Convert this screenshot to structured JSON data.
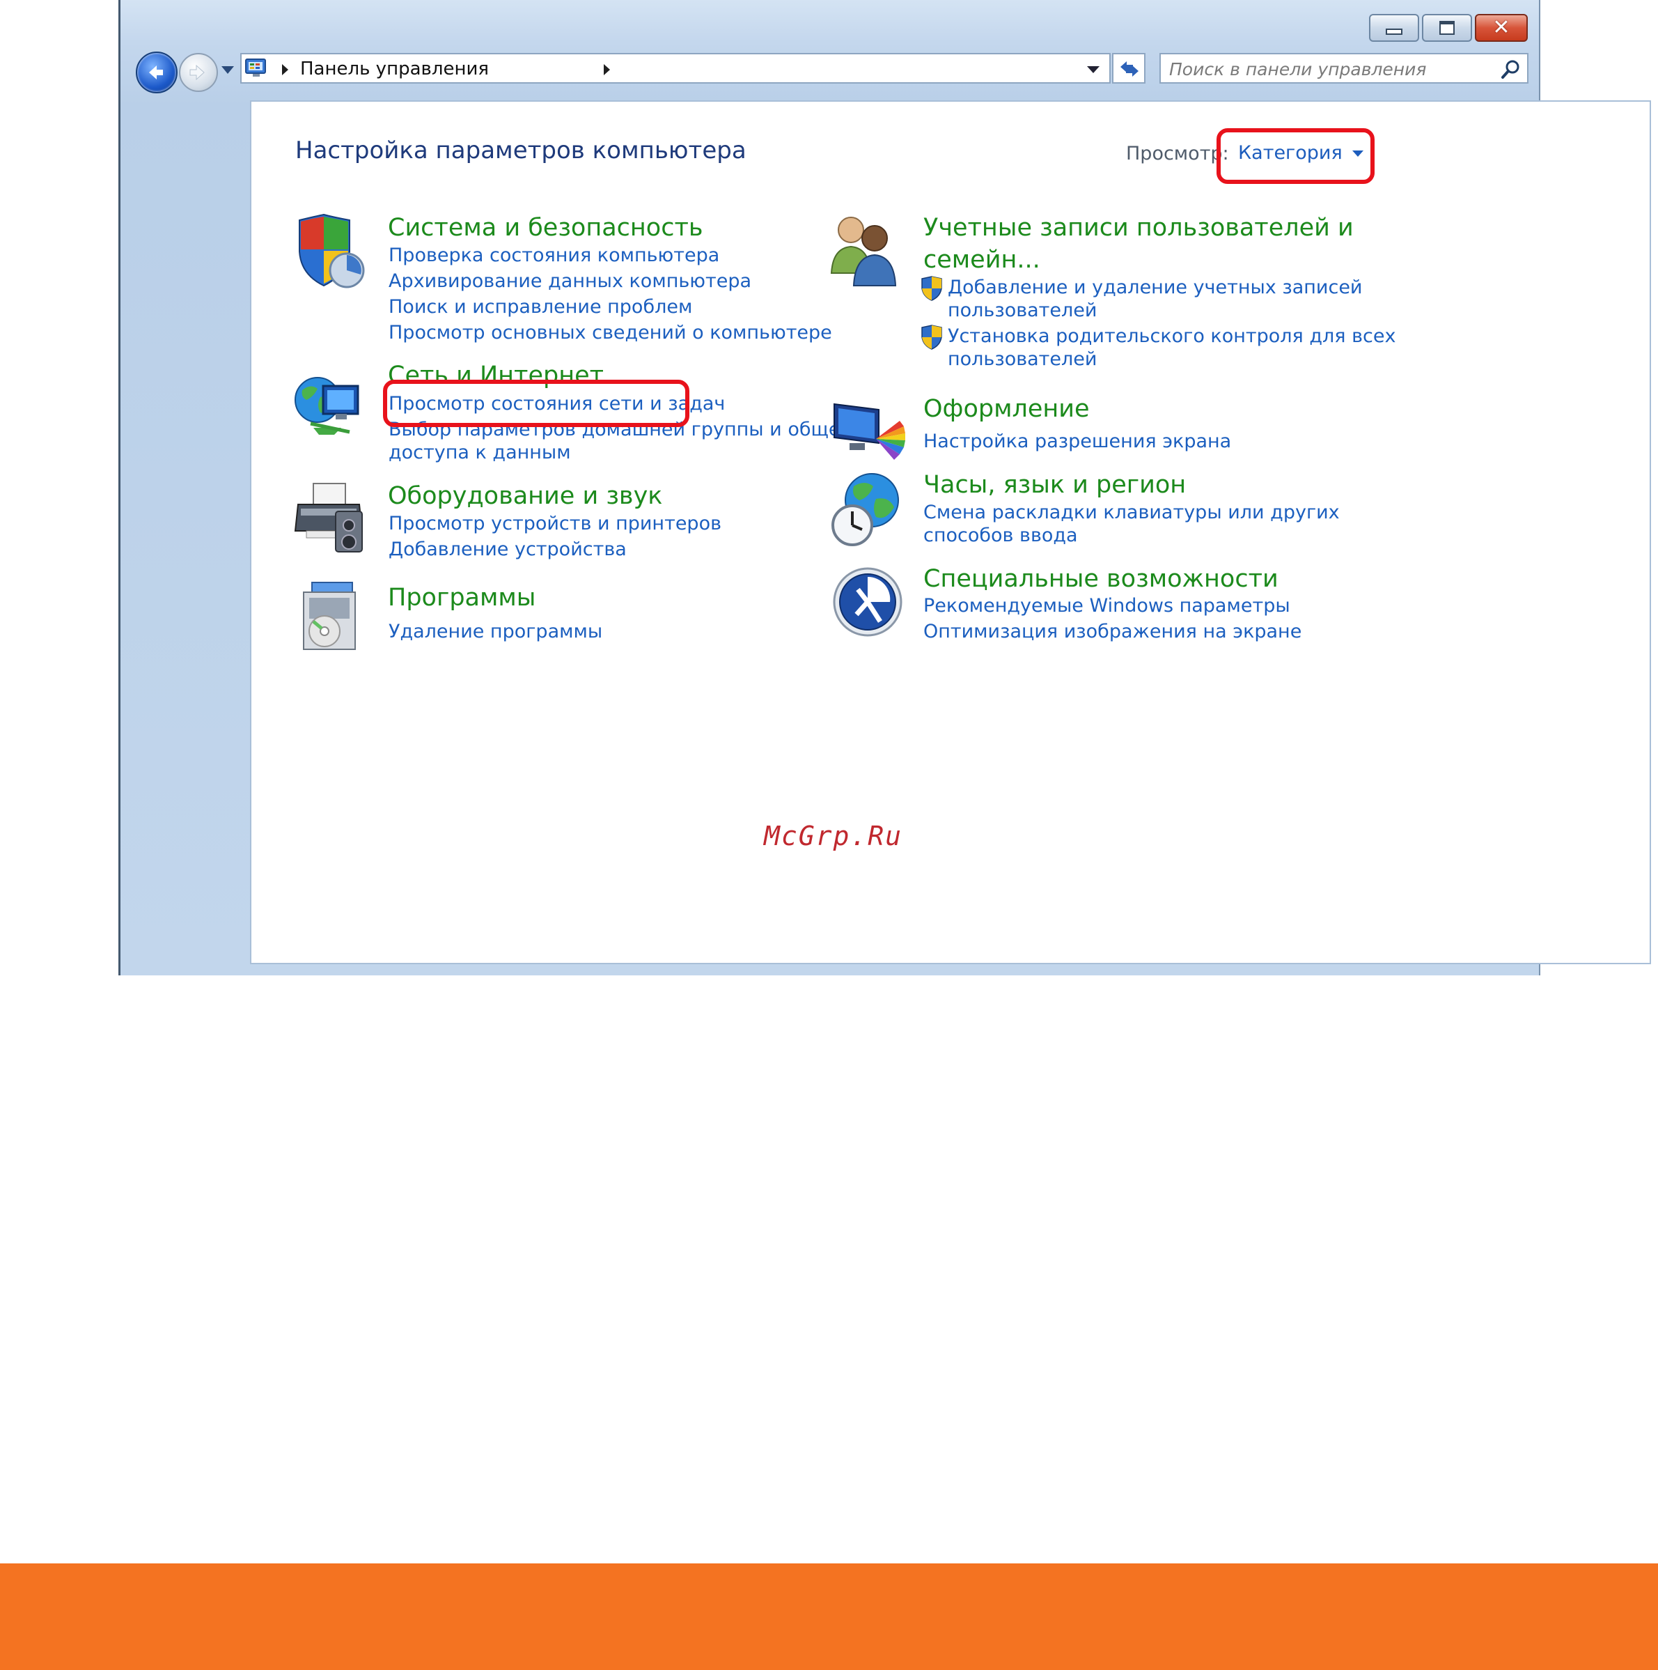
{
  "window": {
    "minimize_label": "",
    "maximize_label": "",
    "close_label": ""
  },
  "address": {
    "breadcrumb": "Панель управления"
  },
  "search": {
    "placeholder": "Поиск в панели управления"
  },
  "header": {
    "title": "Настройка параметров компьютера",
    "view_label": "Просмотр:",
    "view_value": "Категория"
  },
  "categories_left": [
    {
      "title": "Система и безопасность",
      "links": [
        "Проверка состояния компьютера",
        "Архивирование данных компьютера",
        "Поиск и исправление проблем",
        "Просмотр основных сведений о компьютере"
      ]
    },
    {
      "title": "Сеть и Интернет",
      "links": [
        "Просмотр состояния сети и задач",
        "Выбор параметров домашней группы и общего",
        "доступа к данным"
      ]
    },
    {
      "title": "Оборудование и звук",
      "links": [
        "Просмотр устройств и принтеров",
        "Добавление устройства"
      ]
    },
    {
      "title": "Программы",
      "links": [
        "Удаление программы"
      ]
    }
  ],
  "categories_right": [
    {
      "title_line1": "Учетные записи пользователей и",
      "title_line2": "семейн...",
      "links": [
        "Добавление и удаление учетных записей",
        "пользователей",
        "Установка родительского контроля для всех",
        "пользователей"
      ]
    },
    {
      "title": "Оформление",
      "links": [
        "Настройка разрешения экрана"
      ]
    },
    {
      "title": "Часы, язык и регион",
      "links": [
        "Смена раскладки клавиатуры или других",
        "способов ввода"
      ]
    },
    {
      "title": "Специальные возможности",
      "links": [
        "Рекомендуемые Windows параметры",
        "Оптимизация изображения на экране"
      ]
    }
  ],
  "watermark": "McGrp.Ru",
  "colors": {
    "link": "#1c5fbf",
    "category_title": "#1c8a1c",
    "highlight": "#e8121b",
    "footer": "#f47321"
  },
  "icons": [
    "back-arrow-icon",
    "forward-arrow-icon",
    "control-panel-icon",
    "refresh-icon",
    "search-icon",
    "security-shield-icon",
    "network-globe-icon",
    "printer-icon",
    "programs-box-icon",
    "users-icon",
    "display-palette-icon",
    "globe-clock-icon",
    "accessibility-icon",
    "uac-shield-icon"
  ]
}
